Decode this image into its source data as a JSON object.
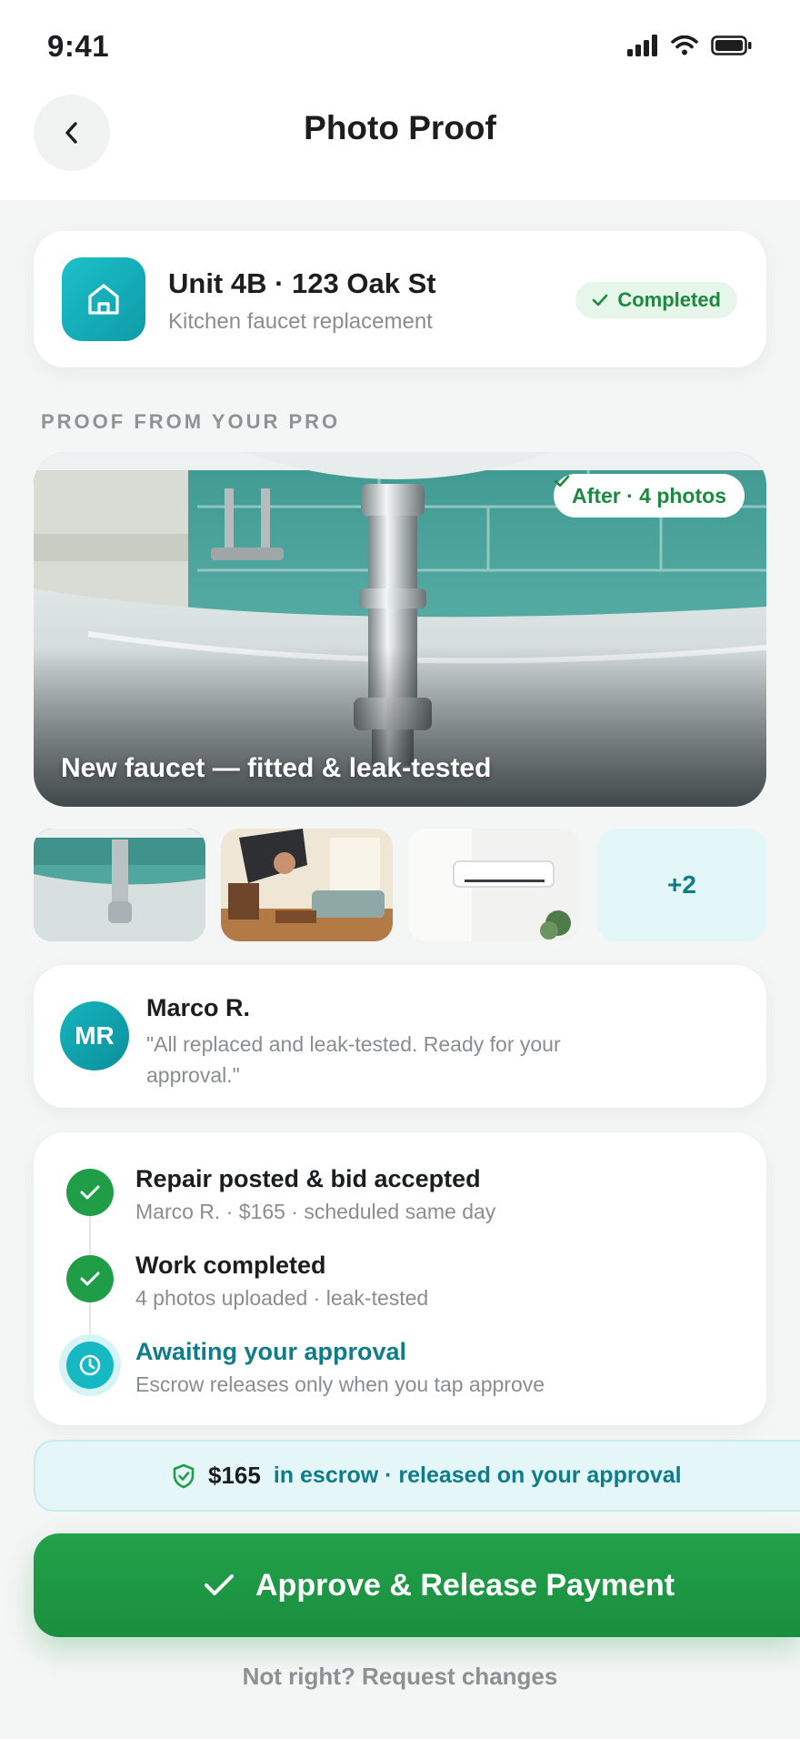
{
  "status_bar": {
    "time": "9:41"
  },
  "header": {
    "title": "Photo Proof"
  },
  "job": {
    "title": "Unit 4B · 123 Oak St",
    "subtitle": "Kitchen faucet replacement",
    "status": "Completed",
    "icon": "home-icon"
  },
  "proof": {
    "section_label": "PROOF FROM YOUR PRO",
    "hero_badge": "After · 4 photos",
    "hero_caption": "New faucet — fitted & leak-tested",
    "more_count": "+2"
  },
  "pro": {
    "initials": "MR",
    "name": "Marco R.",
    "quote": "\"All replaced and leak-tested. Ready for your approval.\""
  },
  "timeline": [
    {
      "title": "Repair posted & bid accepted",
      "subtitle": "Marco R. · $165 · scheduled same day",
      "state": "done"
    },
    {
      "title": "Work completed",
      "subtitle": "4 photos uploaded · leak-tested",
      "state": "done"
    },
    {
      "title": "Awaiting your approval",
      "subtitle": "Escrow releases only when you tap approve",
      "state": "pending"
    }
  ],
  "escrow": {
    "amount": "$165",
    "text": "in escrow · released on your approval"
  },
  "actions": {
    "approve_label": "Approve & Release Payment",
    "request_label": "Not right? Request changes"
  },
  "colors": {
    "accent": "#16b8c3",
    "success": "#1f9d47",
    "teal_text": "#0e7c89"
  }
}
